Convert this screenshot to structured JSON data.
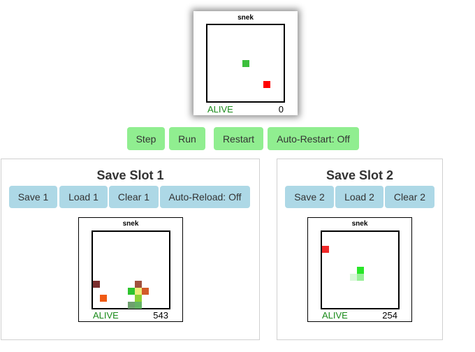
{
  "main_game": {
    "title": "snek",
    "status": "ALIVE",
    "score": "0",
    "cells": [
      {
        "col": 5,
        "row": 5,
        "color": "#3cbf3c"
      },
      {
        "col": 8,
        "row": 8,
        "color": "#ff0000"
      }
    ]
  },
  "controls": {
    "step_label": "Step",
    "run_label": "Run",
    "restart_label": "Restart",
    "auto_restart_label": "Auto-Restart: Off"
  },
  "slot1": {
    "title": "Save Slot 1",
    "save_label": "Save 1",
    "load_label": "Load 1",
    "clear_label": "Clear 1",
    "auto_reload_label": "Auto-Reload: Off",
    "game": {
      "title": "snek",
      "status": "ALIVE",
      "score": "543",
      "cells": [
        {
          "col": 0,
          "row": 7,
          "color": "#7a2e2e"
        },
        {
          "col": 1,
          "row": 9,
          "color": "#f05a14"
        },
        {
          "col": 6,
          "row": 7,
          "color": "#a0503c"
        },
        {
          "col": 6,
          "row": 8,
          "color": "#ecec78"
        },
        {
          "col": 5,
          "row": 8,
          "color": "#2ec42e"
        },
        {
          "col": 7,
          "row": 8,
          "color": "#d25a28"
        },
        {
          "col": 6,
          "row": 9,
          "color": "#8cd232"
        },
        {
          "col": 5,
          "row": 10,
          "color": "#6ea06e"
        },
        {
          "col": 6,
          "row": 10,
          "color": "#64b464"
        }
      ]
    }
  },
  "slot2": {
    "title": "Save Slot 2",
    "save_label": "Save 2",
    "load_label": "Load 2",
    "clear_label": "Clear 2",
    "game": {
      "title": "snek",
      "status": "ALIVE",
      "score": "254",
      "cells": [
        {
          "col": 0,
          "row": 2,
          "color": "#f02828"
        },
        {
          "col": 5,
          "row": 5,
          "color": "#28e628"
        },
        {
          "col": 5,
          "row": 6,
          "color": "#96f096"
        },
        {
          "col": 4,
          "row": 6,
          "color": "#d7f7d7"
        }
      ]
    }
  }
}
